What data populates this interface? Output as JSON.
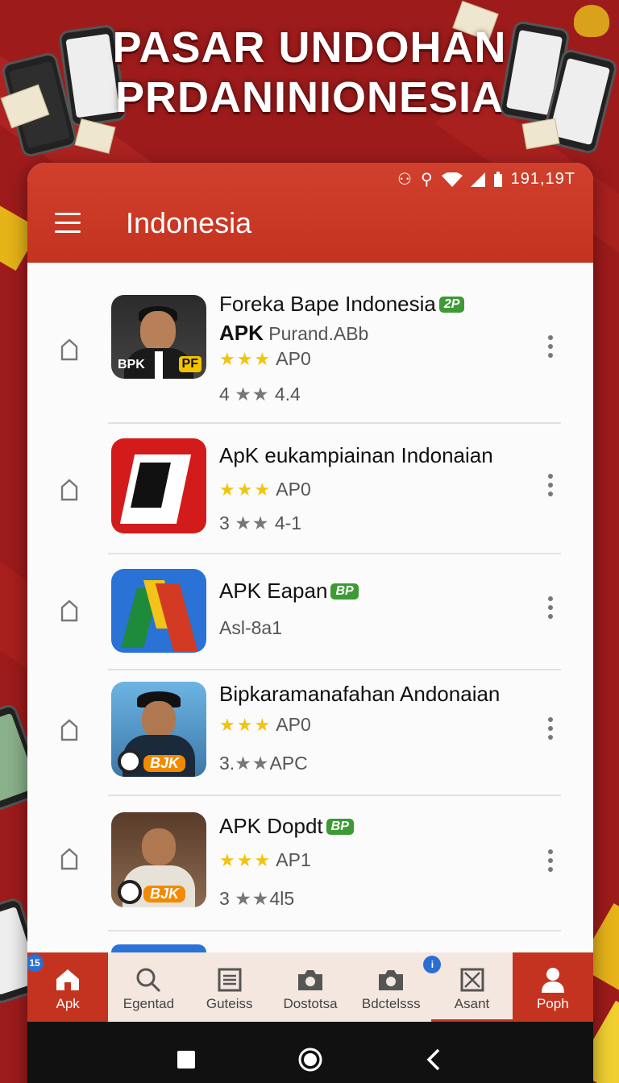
{
  "banner": {
    "line1": "PASAR UNDOHAN",
    "line2": "PRDANINIONESIA"
  },
  "status_bar": {
    "time": "191,19T"
  },
  "app_bar": {
    "title": "Indonesia"
  },
  "apps": [
    {
      "title": "Foreka Bape Indonesia",
      "badge": "2P",
      "subtitle_bold": "APK",
      "subtitle": "Purand.ABb",
      "stars": "★★★",
      "rating_label": "AP0",
      "score_prefix": "4",
      "score_stars": "★★",
      "score_value": "4.4",
      "thumb_brand": "BPK",
      "thumb_tag": "PF"
    },
    {
      "title": "ApK eukampiainan Indonaian",
      "stars": "★★★",
      "rating_label": "AP0",
      "score_prefix": "3",
      "score_stars": "★★",
      "score_value": "4-1"
    },
    {
      "title": "APK Eapan",
      "badge": "BP",
      "subtitle": "Asl-8a1"
    },
    {
      "title": "Bipkaramanafahan Andonaian",
      "stars": "★★★",
      "rating_label": "AP0",
      "score_prefix": "3.",
      "score_stars": "★★",
      "score_value": "APC",
      "thumb_label": "BJK"
    },
    {
      "title": "APK Dopdt",
      "badge": "BP",
      "stars": "★★★",
      "rating_label": "AP1",
      "score_prefix": "3",
      "score_stars": "★★",
      "score_value": "4l5",
      "thumb_label": "BJK"
    }
  ],
  "bottom_nav": {
    "items": [
      {
        "label": "Apk",
        "icon": "home-icon"
      },
      {
        "label": "Egentad",
        "icon": "search-icon"
      },
      {
        "label": "Guteiss",
        "icon": "list-icon"
      },
      {
        "label": "Dostotsa",
        "icon": "camera-icon"
      },
      {
        "label": "Bdctelsss",
        "icon": "camera-icon"
      },
      {
        "label": "Asant",
        "icon": "close-box-icon"
      },
      {
        "label": "Poph",
        "icon": "profile-icon"
      }
    ],
    "badge_left": "15",
    "badge_info": "i"
  },
  "colors": {
    "primary": "#c4331f",
    "background": "#9e1b1b",
    "badge_green": "#3d9a35",
    "star": "#f1c40f"
  }
}
